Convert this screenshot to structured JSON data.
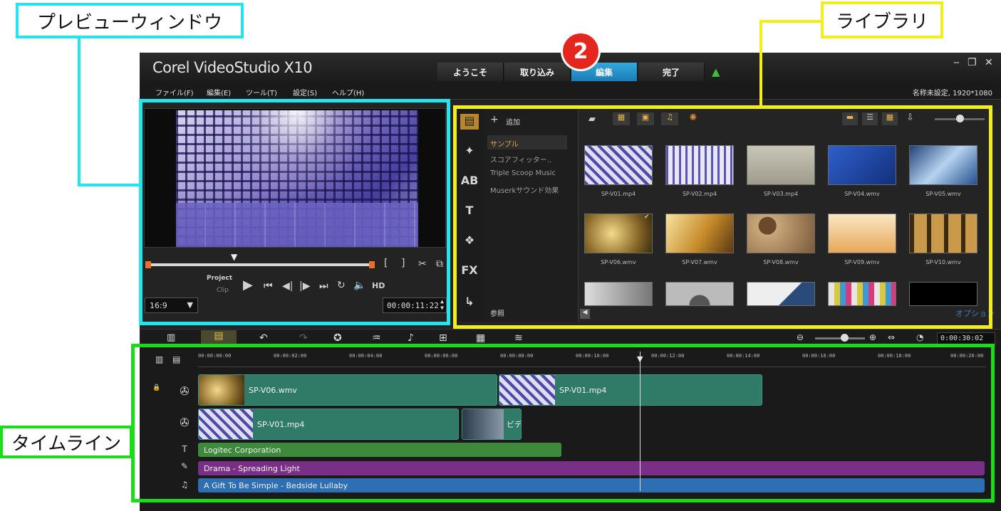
{
  "annotations": {
    "preview": "プレビューウィンドウ",
    "library": "ライブラリ",
    "timeline": "タイムライン",
    "step_number": "2"
  },
  "app": {
    "brand": "Corel VideoStudio X10",
    "steps": [
      "ようこそ",
      "取り込み",
      "編集",
      "完了"
    ],
    "active_step": "編集",
    "menu": [
      "ファイル(F)",
      "編集(E)",
      "ツール(T)",
      "設定(S)",
      "ヘルプ(H)"
    ],
    "project_info": "名称未設定, 1920*1080"
  },
  "preview": {
    "project_label": "Project",
    "clip_label": "Clip",
    "hd_label": "HD",
    "aspect": "16:9",
    "timecode": "00:00:11:22"
  },
  "library": {
    "add_label": "追加",
    "folders": [
      "サンプル",
      "スコアフィッター..",
      "Triple Scoop Music",
      "Muserkサウンド効果"
    ],
    "browse_label": "参照",
    "option_label": "オプション",
    "items": [
      {
        "name": "SP-V01.mp4",
        "checked": true
      },
      {
        "name": "SP-V02.mp4",
        "checked": false
      },
      {
        "name": "SP-V03.mp4",
        "checked": false
      },
      {
        "name": "SP-V04.wmv",
        "checked": false
      },
      {
        "name": "SP-V05.wmv",
        "checked": false
      },
      {
        "name": "SP-V06.wmv",
        "checked": true
      },
      {
        "name": "SP-V07.wmv",
        "checked": false
      },
      {
        "name": "SP-V08.wmv",
        "checked": false
      },
      {
        "name": "SP-V09.wmv",
        "checked": false
      },
      {
        "name": "SP-V10.wmv",
        "checked": false
      }
    ]
  },
  "timeline": {
    "timecode": "0:00:30:02",
    "ruler": [
      "00:00:00:00",
      "00:00:02:00",
      "00:00:04:00",
      "00:00:06:00",
      "00:00:08:00",
      "00:00:10:00",
      "00:00:12:00",
      "00:00:14:00",
      "00:00:16:00",
      "00:00:18:00",
      "00:00:20:00"
    ],
    "video_track_clips": [
      "SP-V06.wmv",
      "SP-V01.mp4"
    ],
    "overlay_track_clips": [
      "SP-V01.mp4",
      "ビデ"
    ],
    "title_clip": "Logitec Corporation",
    "fx_clip": "Drama - Spreading Light",
    "audio_clip": "A Gift To Be Simple - Bedside Lullaby"
  },
  "colors": {
    "preview_callout": "#22e6ee",
    "library_callout": "#f2ee19",
    "timeline_callout": "#19dd19",
    "active_tab": "#2a95cf",
    "step_badge": "#e5261f"
  }
}
